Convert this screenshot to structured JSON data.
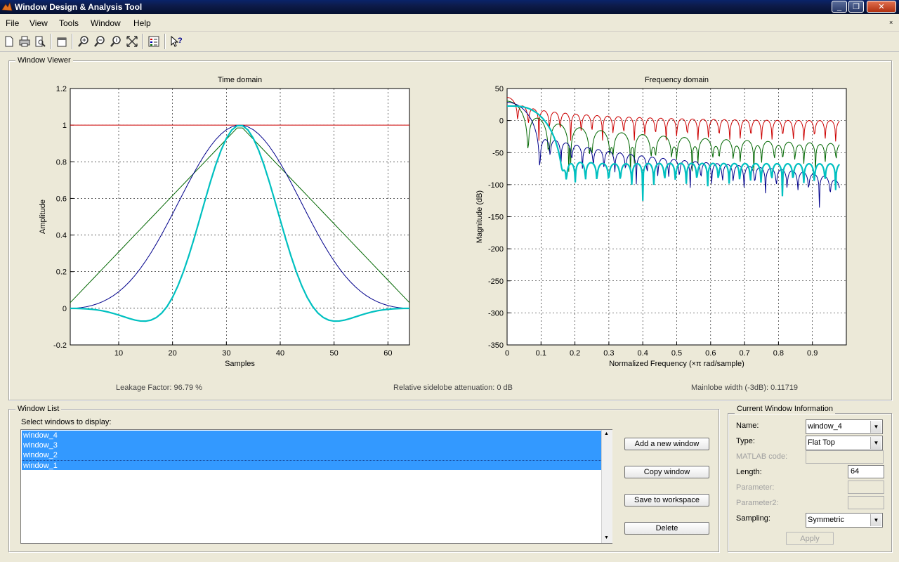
{
  "window": {
    "title": "Window Design & Analysis Tool",
    "buttons": [
      "minimize-icon",
      "maximize-icon",
      "close-icon"
    ]
  },
  "menubar": [
    "File",
    "View",
    "Tools",
    "Window",
    "Help"
  ],
  "toolbar_icons": [
    "new-icon",
    "print-icon",
    "print-preview-icon",
    "new-figure-icon",
    "zoom-in-icon",
    "zoom-x-icon",
    "zoom-y-icon",
    "full-view-icon",
    "legend-icon",
    "whats-this-icon"
  ],
  "viewer": {
    "title": "Window Viewer",
    "leakage": "Leakage Factor: 96.79 %",
    "sidelobe": "Relative sidelobe attenuation: 0 dB",
    "mainlobe": "Mainlobe width (-3dB): 0.11719"
  },
  "colors": {
    "window_1": "#cc0000",
    "window_2": "#006600",
    "window_3": "#00008b",
    "window_4": "#00c0c0"
  },
  "chart_data": [
    {
      "type": "line",
      "title": "Time domain",
      "xlabel": "Samples",
      "ylabel": "Amplitude",
      "xlim": [
        1,
        64
      ],
      "ylim": [
        -0.2,
        1.2
      ],
      "xticks": [
        "10",
        "20",
        "30",
        "40",
        "50",
        "60"
      ],
      "yticks": [
        "-0.2",
        "0",
        "0.2",
        "0.4",
        "0.6",
        "0.8",
        "1",
        "1.2"
      ],
      "grid": true,
      "series": [
        {
          "name": "window_1",
          "shape": "rectangular",
          "N": 64
        },
        {
          "name": "window_2",
          "shape": "triangular",
          "N": 64
        },
        {
          "name": "window_3",
          "shape": "blackman",
          "N": 64
        },
        {
          "name": "window_4",
          "shape": "flattop",
          "N": 64
        }
      ]
    },
    {
      "type": "line",
      "title": "Frequency domain",
      "xlabel": "Normalized Frequency  (×π rad/sample)",
      "ylabel": "Magnitude (dB)",
      "xlim": [
        0,
        1
      ],
      "ylim": [
        -350,
        50
      ],
      "xticks": [
        "0",
        "0.1",
        "0.2",
        "0.3",
        "0.4",
        "0.5",
        "0.6",
        "0.7",
        "0.8",
        "0.9"
      ],
      "yticks": [
        "-350",
        "-300",
        "-250",
        "-200",
        "-150",
        "-100",
        "-50",
        "0",
        "50"
      ],
      "grid": true,
      "series": [
        {
          "name": "window_1"
        },
        {
          "name": "window_2"
        },
        {
          "name": "window_3"
        },
        {
          "name": "window_4"
        }
      ]
    }
  ],
  "window_list": {
    "title": "Window List",
    "prompt": "Select windows to display:",
    "items": [
      "window_4",
      "window_3",
      "window_2",
      "window_1"
    ],
    "buttons": {
      "add": "Add a new window",
      "copy": "Copy window",
      "save": "Save to workspace",
      "delete": "Delete"
    }
  },
  "info": {
    "title": "Current Window Information",
    "name_label": "Name:",
    "name_value": "window_4",
    "type_label": "Type:",
    "type_value": "Flat Top",
    "matlab_label": "MATLAB code:",
    "length_label": "Length:",
    "length_value": "64",
    "param_label": "Parameter:",
    "param2_label": "Parameter2:",
    "sampling_label": "Sampling:",
    "sampling_value": "Symmetric",
    "apply_label": "Apply"
  }
}
